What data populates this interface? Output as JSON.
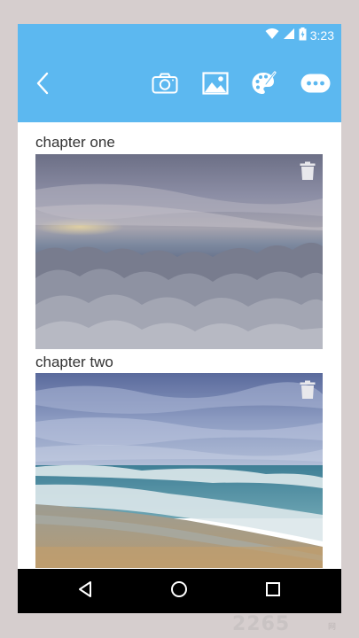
{
  "status_bar": {
    "time": "3:23",
    "icons": [
      "wifi-icon",
      "signal-icon",
      "battery-charging-icon"
    ]
  },
  "toolbar": {
    "background": "#5cb8f0",
    "buttons": [
      "back-icon",
      "camera-icon",
      "image-icon",
      "palette-icon",
      "more-icon"
    ]
  },
  "chapters": [
    {
      "title": "chapter one",
      "image": "cloudscape-photo"
    },
    {
      "title": "chapter two",
      "image": "beach-waves-photo"
    }
  ],
  "navigation_bar": {
    "buttons": [
      "back-triangle-icon",
      "home-circle-icon",
      "recents-square-icon"
    ]
  },
  "watermark": {
    "text": "2265",
    "suffix": "网"
  }
}
